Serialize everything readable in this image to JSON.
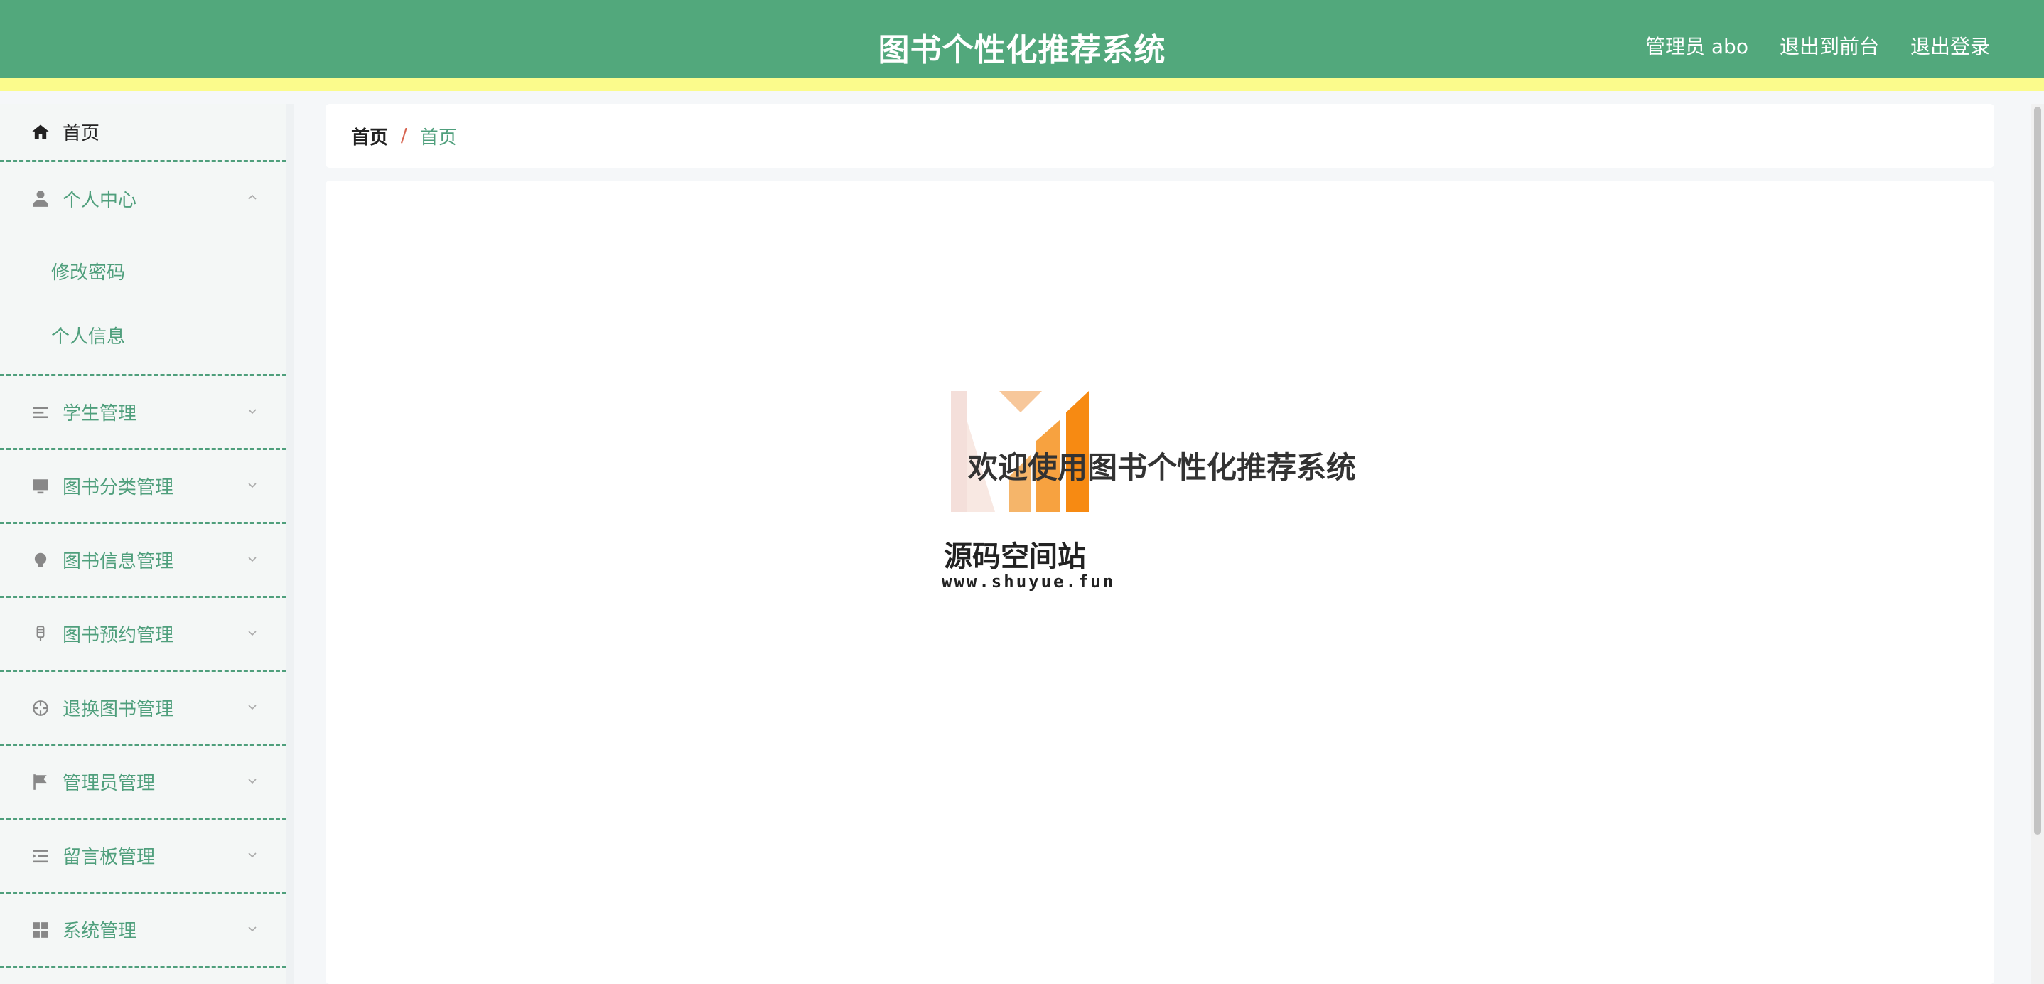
{
  "header": {
    "title": "图书个性化推荐系统",
    "user_label": "管理员 abo",
    "to_front": "退出到前台",
    "logout": "退出登录"
  },
  "sidebar": {
    "home": "首页",
    "personal_center": {
      "label": "个人中心",
      "children": [
        "修改密码",
        "个人信息"
      ]
    },
    "items": [
      {
        "label": "学生管理",
        "icon": "list-icon"
      },
      {
        "label": "图书分类管理",
        "icon": "monitor-icon"
      },
      {
        "label": "图书信息管理",
        "icon": "bulb-icon"
      },
      {
        "label": "图书预约管理",
        "icon": "mic-icon"
      },
      {
        "label": "退换图书管理",
        "icon": "target-icon"
      },
      {
        "label": "管理员管理",
        "icon": "flag-icon"
      },
      {
        "label": "留言板管理",
        "icon": "indent-icon"
      },
      {
        "label": "系统管理",
        "icon": "grid-icon"
      }
    ]
  },
  "breadcrumb": [
    "首页",
    "/",
    "首页"
  ],
  "main": {
    "welcome": "欢迎使用图书个性化推荐系统",
    "watermark_name": "源码空间站",
    "watermark_url": "www.shuyue.fun"
  },
  "colors": {
    "header_bg": "#52a87c",
    "header_stripe": "#fbfb8c",
    "accent": "#4f9f7c",
    "breadcrumb_sep": "#d6614d"
  }
}
